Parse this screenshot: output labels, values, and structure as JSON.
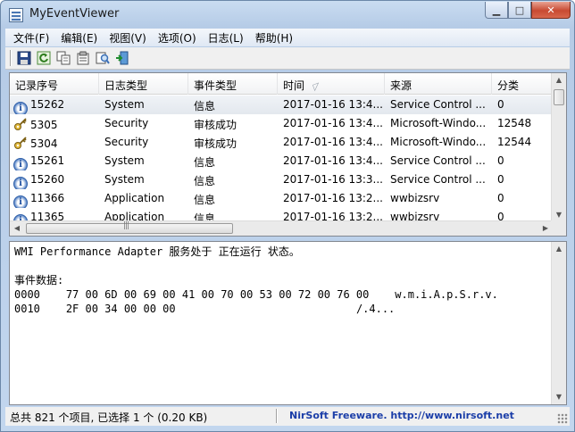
{
  "window": {
    "title": "MyEventViewer"
  },
  "menu": [
    "文件(F)",
    "编辑(E)",
    "视图(V)",
    "选项(O)",
    "日志(L)",
    "帮助(H)"
  ],
  "toolbar": [
    "save-icon",
    "refresh-icon",
    "copy-icon",
    "properties-icon",
    "find-icon",
    "exit-icon"
  ],
  "list": {
    "columns": [
      "记录序号",
      "日志类型",
      "事件类型",
      "时间",
      "来源",
      "分类"
    ],
    "rows": [
      {
        "icon": "info",
        "id": "15262",
        "log": "System",
        "type": "信息",
        "time": "2017-01-16 13:4...",
        "source": "Service Control ...",
        "cat": "0"
      },
      {
        "icon": "key",
        "id": "5305",
        "log": "Security",
        "type": "审核成功",
        "time": "2017-01-16 13:4...",
        "source": "Microsoft-Windo...",
        "cat": "12548"
      },
      {
        "icon": "key",
        "id": "5304",
        "log": "Security",
        "type": "审核成功",
        "time": "2017-01-16 13:4...",
        "source": "Microsoft-Windo...",
        "cat": "12544"
      },
      {
        "icon": "info",
        "id": "15261",
        "log": "System",
        "type": "信息",
        "time": "2017-01-16 13:4...",
        "source": "Service Control ...",
        "cat": "0"
      },
      {
        "icon": "info",
        "id": "15260",
        "log": "System",
        "type": "信息",
        "time": "2017-01-16 13:3...",
        "source": "Service Control ...",
        "cat": "0"
      },
      {
        "icon": "info",
        "id": "11366",
        "log": "Application",
        "type": "信息",
        "time": "2017-01-16 13:2...",
        "source": "wwbizsrv",
        "cat": "0"
      },
      {
        "icon": "info",
        "id": "11365",
        "log": "Application",
        "type": "信息",
        "time": "2017-01-16 13:2...",
        "source": "wwbizsrv",
        "cat": "0"
      }
    ]
  },
  "detail": {
    "message": "WMI Performance Adapter 服务处于 正在运行 状态。",
    "data_label": "事件数据:",
    "hex_lines": [
      {
        "offset": "0000",
        "hex": "77 00 6D 00 69 00 41 00 70 00 53 00 72 00 76 00",
        "ascii": "w.m.i.A.p.S.r.v."
      },
      {
        "offset": "0010",
        "hex": "2F 00 34 00 00 00",
        "ascii": "/.4..."
      }
    ]
  },
  "status": {
    "summary": "总共 821 个项目, 已选择 1 个  (0.20 KB)",
    "brand": "NirSoft Freeware.  http://www.nirsoft.net"
  },
  "colors": {
    "brand_link": "#1b3ea8",
    "selected_row": "#e8ecf1"
  }
}
